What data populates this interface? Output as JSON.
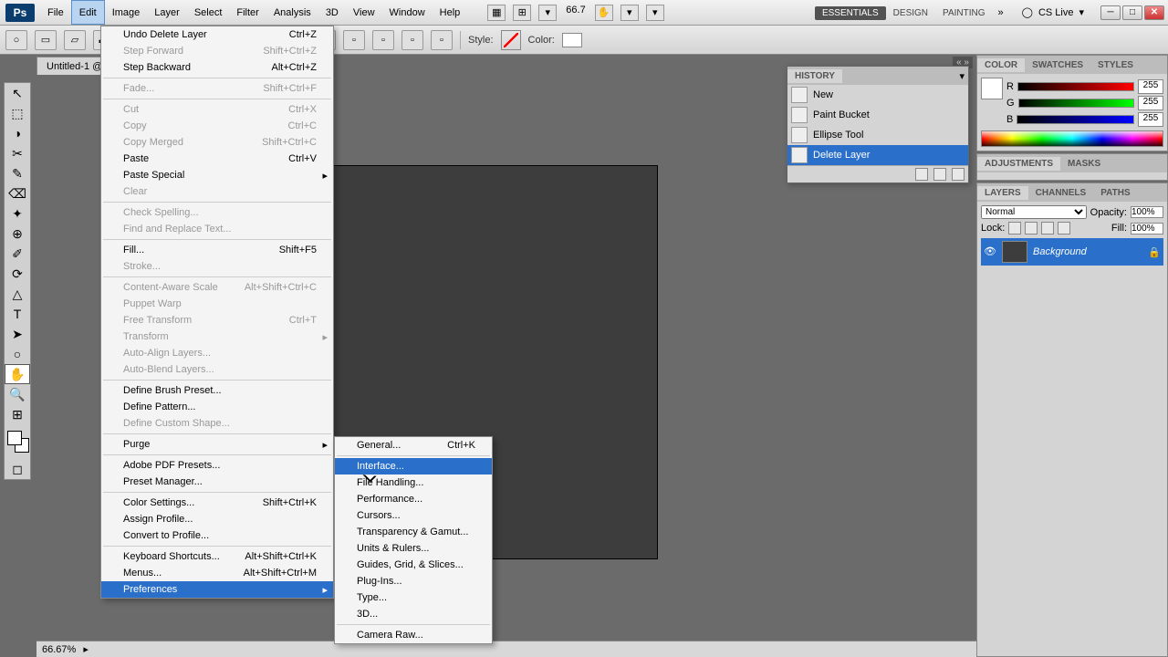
{
  "app_icon": "Ps",
  "menu": [
    "File",
    "Edit",
    "Image",
    "Layer",
    "Select",
    "Filter",
    "Analysis",
    "3D",
    "View",
    "Window",
    "Help"
  ],
  "menu_active_index": 1,
  "zoom_top": "66.7",
  "workspaces": [
    "ESSENTIALS",
    "DESIGN",
    "PAINTING"
  ],
  "cslive": "CS Live",
  "doc_tab": "Untitled-1 @",
  "status_zoom": "66.67%",
  "options": {
    "style": "Style:",
    "color": "Color:"
  },
  "edit_menu": [
    {
      "label": "Undo Delete Layer",
      "sc": "Ctrl+Z"
    },
    {
      "label": "Step Forward",
      "sc": "Shift+Ctrl+Z",
      "disabled": true
    },
    {
      "label": "Step Backward",
      "sc": "Alt+Ctrl+Z"
    },
    {
      "sep": true
    },
    {
      "label": "Fade...",
      "sc": "Shift+Ctrl+F",
      "disabled": true
    },
    {
      "sep": true
    },
    {
      "label": "Cut",
      "sc": "Ctrl+X",
      "disabled": true
    },
    {
      "label": "Copy",
      "sc": "Ctrl+C",
      "disabled": true
    },
    {
      "label": "Copy Merged",
      "sc": "Shift+Ctrl+C",
      "disabled": true
    },
    {
      "label": "Paste",
      "sc": "Ctrl+V"
    },
    {
      "label": "Paste Special",
      "sub": true
    },
    {
      "label": "Clear",
      "disabled": true
    },
    {
      "sep": true
    },
    {
      "label": "Check Spelling...",
      "disabled": true
    },
    {
      "label": "Find and Replace Text...",
      "disabled": true
    },
    {
      "sep": true
    },
    {
      "label": "Fill...",
      "sc": "Shift+F5"
    },
    {
      "label": "Stroke...",
      "disabled": true
    },
    {
      "sep": true
    },
    {
      "label": "Content-Aware Scale",
      "sc": "Alt+Shift+Ctrl+C",
      "disabled": true
    },
    {
      "label": "Puppet Warp",
      "disabled": true
    },
    {
      "label": "Free Transform",
      "sc": "Ctrl+T",
      "disabled": true
    },
    {
      "label": "Transform",
      "disabled": true,
      "sub": true
    },
    {
      "label": "Auto-Align Layers...",
      "disabled": true
    },
    {
      "label": "Auto-Blend Layers...",
      "disabled": true
    },
    {
      "sep": true
    },
    {
      "label": "Define Brush Preset..."
    },
    {
      "label": "Define Pattern..."
    },
    {
      "label": "Define Custom Shape...",
      "disabled": true
    },
    {
      "sep": true
    },
    {
      "label": "Purge",
      "sub": true
    },
    {
      "sep": true
    },
    {
      "label": "Adobe PDF Presets..."
    },
    {
      "label": "Preset Manager..."
    },
    {
      "sep": true
    },
    {
      "label": "Color Settings...",
      "sc": "Shift+Ctrl+K"
    },
    {
      "label": "Assign Profile..."
    },
    {
      "label": "Convert to Profile..."
    },
    {
      "sep": true
    },
    {
      "label": "Keyboard Shortcuts...",
      "sc": "Alt+Shift+Ctrl+K"
    },
    {
      "label": "Menus...",
      "sc": "Alt+Shift+Ctrl+M"
    },
    {
      "label": "Preferences",
      "sub": true,
      "hover": true
    }
  ],
  "prefs_submenu": [
    {
      "label": "General...",
      "sc": "Ctrl+K"
    },
    {
      "sep": true
    },
    {
      "label": "Interface...",
      "hover": true
    },
    {
      "label": "File Handling..."
    },
    {
      "label": "Performance..."
    },
    {
      "label": "Cursors..."
    },
    {
      "label": "Transparency & Gamut..."
    },
    {
      "label": "Units & Rulers..."
    },
    {
      "label": "Guides, Grid, & Slices..."
    },
    {
      "label": "Plug-Ins..."
    },
    {
      "label": "Type..."
    },
    {
      "label": "3D..."
    },
    {
      "sep": true
    },
    {
      "label": "Camera Raw..."
    }
  ],
  "history": {
    "title": "HISTORY",
    "items": [
      "New",
      "Paint Bucket",
      "Ellipse Tool",
      "Delete Layer"
    ],
    "active_index": 3
  },
  "color_panel": {
    "tabs": [
      "COLOR",
      "SWATCHES",
      "STYLES"
    ],
    "channels": [
      "R",
      "G",
      "B"
    ],
    "values": [
      "255",
      "255",
      "255"
    ]
  },
  "adjust_tabs": [
    "ADJUSTMENTS",
    "MASKS"
  ],
  "layers_panel": {
    "tabs": [
      "LAYERS",
      "CHANNELS",
      "PATHS"
    ],
    "mode": "Normal",
    "opacity_label": "Opacity:",
    "opacity": "100%",
    "lock_label": "Lock:",
    "fill_label": "Fill:",
    "fill": "100%",
    "layer_name": "Background"
  },
  "tools": [
    "↖",
    "⬚",
    "◑",
    "✂",
    "✎",
    "⌫",
    "✦",
    "⊕",
    "✐",
    "⟳",
    "△",
    "T",
    "➤",
    "○",
    "✋",
    "🔍",
    "⊞"
  ]
}
